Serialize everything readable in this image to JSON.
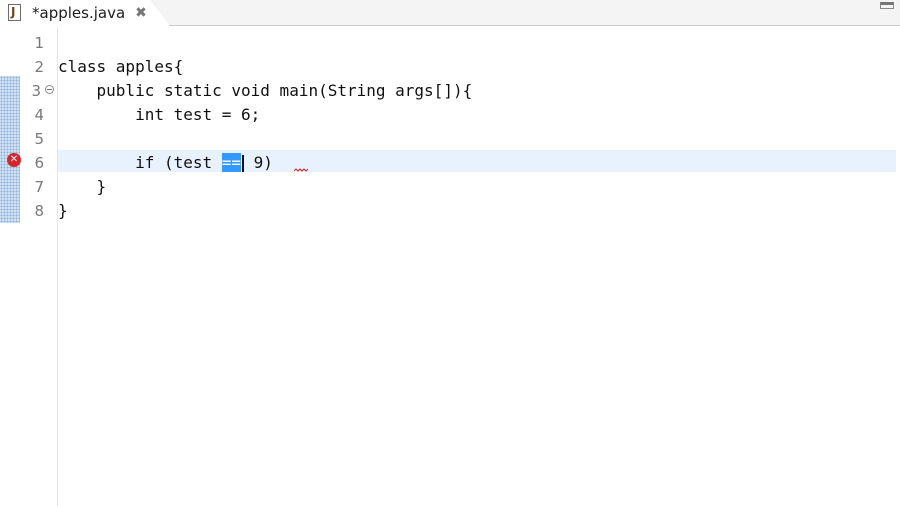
{
  "tab": {
    "title": "*apples.java",
    "icon": "java-file-icon",
    "icon_letter": "J",
    "close": "✖"
  },
  "editor": {
    "line_numbers": [
      "1",
      "2",
      "3",
      "4",
      "5",
      "6",
      "7",
      "8"
    ],
    "lines": [
      "",
      "class apples{",
      "    public static void main(String args[]){",
      "        int test = 6;",
      "",
      "        if (test ",
      "    }",
      "}"
    ],
    "line6_selected": "==",
    "line6_rest": " 9)",
    "current_line": 6,
    "error_line": 6,
    "error_icon": "error-icon",
    "colors": {
      "selection": "#3399ff",
      "current_line": "#e8f2fe",
      "error": "#d7252a",
      "ruler": "#cfe0f2"
    }
  }
}
